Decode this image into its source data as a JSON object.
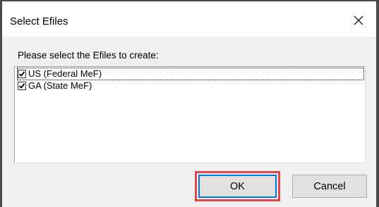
{
  "window": {
    "title": "Select Efiles"
  },
  "dialog": {
    "prompt": "Please select the Efiles to create:",
    "items": [
      {
        "label": "US (Federal MeF)",
        "checked": true,
        "focused": true
      },
      {
        "label": "GA (State MeF)",
        "checked": true,
        "focused": false
      }
    ],
    "ok_label": "OK",
    "cancel_label": "Cancel"
  },
  "icons": {
    "close": "close-icon",
    "check": "checkmark-icon"
  },
  "colors": {
    "highlight": "#e0474c",
    "default_button_border": "#0078d7",
    "client_background": "#f0f0f0"
  }
}
